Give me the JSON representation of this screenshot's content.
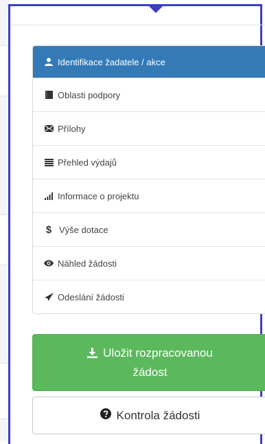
{
  "menu": {
    "items": [
      {
        "label": "Identifikace žadatele / akce",
        "icon": "user-icon",
        "active": true
      },
      {
        "label": "Oblasti podpory",
        "icon": "book-icon",
        "active": false
      },
      {
        "label": "Přílohy",
        "icon": "envelope-icon",
        "active": false
      },
      {
        "label": "Přehled výdajů",
        "icon": "list-icon",
        "active": false
      },
      {
        "label": "Informace o projektu",
        "icon": "signal-icon",
        "active": false
      },
      {
        "label": "Výše dotace",
        "icon": "dollar-icon",
        "active": false
      },
      {
        "label": "Náhled žádosti",
        "icon": "eye-icon",
        "active": false
      },
      {
        "label": "Odeslání žádosti",
        "icon": "send-icon",
        "active": false
      }
    ]
  },
  "actions": {
    "save_line1": "Uložit rozpracovanou",
    "save_line2": "žádost",
    "check_label": "Kontrola žádosti"
  },
  "colors": {
    "active": "#337ab7",
    "success": "#5cb85c",
    "highlight_frame": "#3a3fc4"
  }
}
